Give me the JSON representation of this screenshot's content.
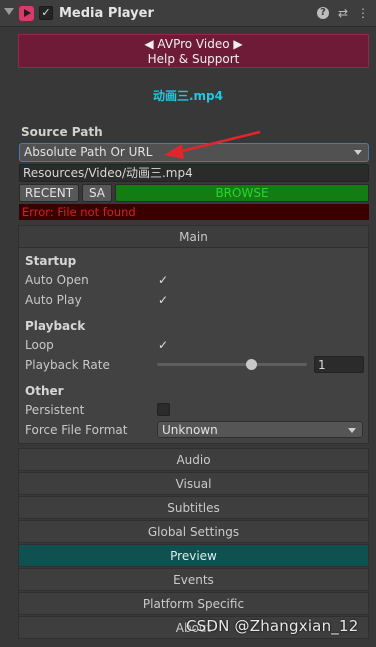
{
  "header": {
    "title": "Media Player",
    "enabled_check": "✓",
    "help_glyph": "?",
    "settings_glyph": "⇄",
    "menu_glyph": "⋮"
  },
  "banner": {
    "line1": "◀ AVPro Video ▶",
    "line2": "Help & Support"
  },
  "file": {
    "name": "动画三.mp4"
  },
  "source": {
    "label": "Source Path",
    "path_type": "Absolute Path Or URL",
    "url_value": "Resources/Video/动画三.mp4",
    "recent_label": "RECENT",
    "sa_label": "SA",
    "browse_label": "BROWSE",
    "error_text": "Error: File not found"
  },
  "main": {
    "tab_label": "Main",
    "startup_heading": "Startup",
    "auto_open_label": "Auto Open",
    "auto_open_check": "✓",
    "auto_play_label": "Auto Play",
    "auto_play_check": "✓",
    "playback_heading": "Playback",
    "loop_label": "Loop",
    "loop_check": "✓",
    "playback_rate_label": "Playback Rate",
    "playback_rate_value": "1",
    "other_heading": "Other",
    "persistent_label": "Persistent",
    "force_format_label": "Force File Format",
    "force_format_value": "Unknown"
  },
  "sections": [
    {
      "label": "Audio"
    },
    {
      "label": "Visual"
    },
    {
      "label": "Subtitles"
    },
    {
      "label": "Global Settings"
    },
    {
      "label": "Preview"
    },
    {
      "label": "Events"
    },
    {
      "label": "Platform Specific"
    },
    {
      "label": "About"
    }
  ],
  "watermark": "CSDN @Zhangxian_12",
  "colors": {
    "banner": "#6e1b38",
    "filename": "#1fc8e0",
    "browse": "#137d13",
    "error": "#d12222",
    "preview_active": "#0f5151",
    "annotation_arrow": "#e0262a"
  }
}
